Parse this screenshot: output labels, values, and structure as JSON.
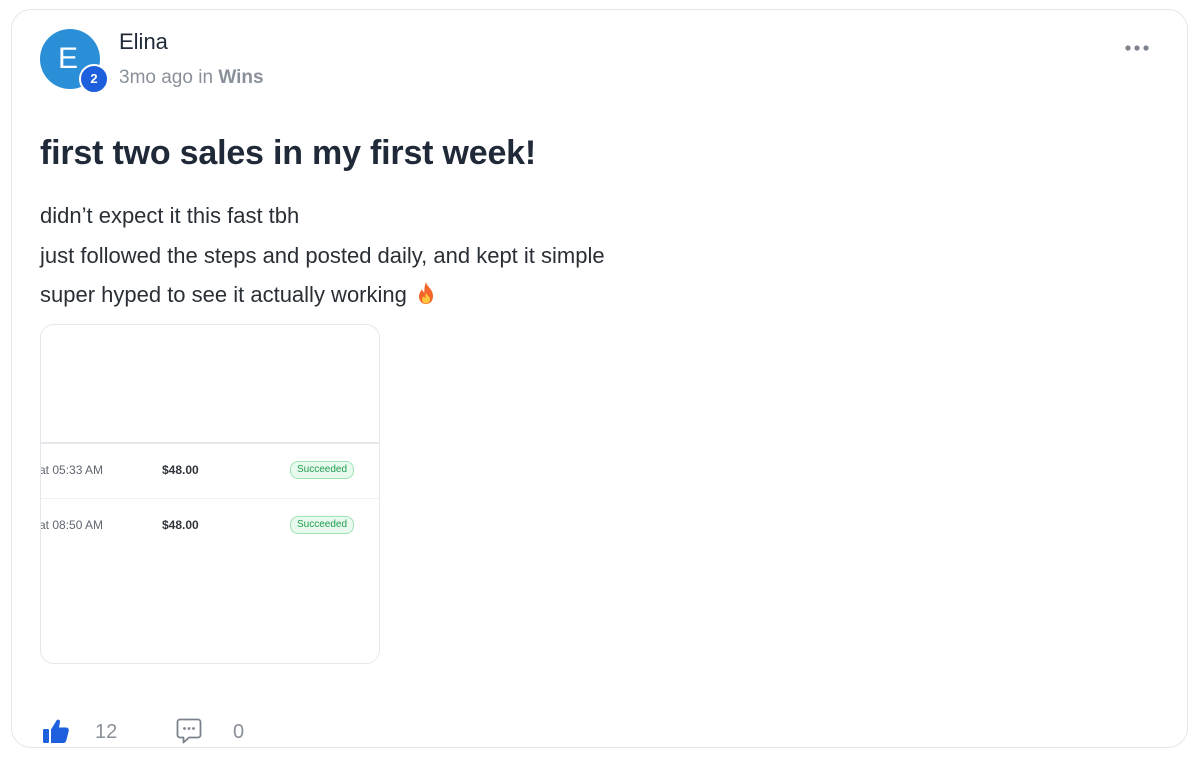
{
  "post": {
    "author": {
      "name": "Elina",
      "avatar_letter": "E",
      "avatar_color": "#2b8fd8",
      "level": "2",
      "level_badge_color": "#1d5fdc"
    },
    "meta": {
      "time": "3mo ago",
      "in_label": "in",
      "category": "Wins"
    },
    "title": "first two sales in my first week!",
    "body_lines": [
      "didn’t expect it this fast tbh",
      "just followed the steps and posted daily, and kept it simple",
      "super hyped to see it actually working"
    ],
    "body_emoji_icon": "fire-icon",
    "attachment": {
      "rows": [
        {
          "time": "at 05:33 AM",
          "amount": "$48.00",
          "status": "Succeeded"
        },
        {
          "time": "at 08:50 AM",
          "amount": "$48.00",
          "status": "Succeeded"
        }
      ],
      "status_color": "#1f9e4d"
    },
    "actions": {
      "like_icon": "thumbs-up-icon",
      "like_count": "12",
      "like_color": "#1d5fdc",
      "comment_icon": "comment-icon",
      "comment_count": "0"
    },
    "menu_icon": "more-options-icon"
  }
}
